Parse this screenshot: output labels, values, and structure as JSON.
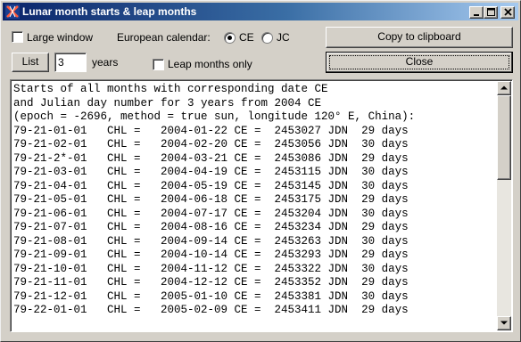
{
  "window": {
    "title": "Lunar month starts & leap months",
    "title_buttons": {
      "minimize": "_",
      "maximize": "□",
      "close": "×"
    }
  },
  "options": {
    "large_window_label": "Large window",
    "large_window_checked": false,
    "calendar_label": "European calendar:",
    "ce_label": "CE",
    "jc_label": "JC",
    "selected_calendar": "CE",
    "leap_months_only_label": "Leap months only",
    "leap_months_only_checked": false
  },
  "controls": {
    "list_button": "List",
    "years_value": "3",
    "years_label": "years",
    "copy_button": "Copy to clipboard",
    "close_button": "Close"
  },
  "output": {
    "header_lines": [
      "Starts of all months with corresponding date CE",
      "and Julian day number for 3 years from 2004 CE",
      "(epoch = -2696, method = true sun, longitude 120° E, China):"
    ],
    "columns": [
      "CHL",
      "CE",
      "JDN",
      "days"
    ],
    "rows": [
      {
        "chl": "79-21-01-01",
        "ce": "2004-01-22",
        "jdn": "2453027",
        "days": "29"
      },
      {
        "chl": "79-21-02-01",
        "ce": "2004-02-20",
        "jdn": "2453056",
        "days": "30"
      },
      {
        "chl": "79-21-2*-01",
        "ce": "2004-03-21",
        "jdn": "2453086",
        "days": "29"
      },
      {
        "chl": "79-21-03-01",
        "ce": "2004-04-19",
        "jdn": "2453115",
        "days": "30"
      },
      {
        "chl": "79-21-04-01",
        "ce": "2004-05-19",
        "jdn": "2453145",
        "days": "30"
      },
      {
        "chl": "79-21-05-01",
        "ce": "2004-06-18",
        "jdn": "2453175",
        "days": "29"
      },
      {
        "chl": "79-21-06-01",
        "ce": "2004-07-17",
        "jdn": "2453204",
        "days": "30"
      },
      {
        "chl": "79-21-07-01",
        "ce": "2004-08-16",
        "jdn": "2453234",
        "days": "29"
      },
      {
        "chl": "79-21-08-01",
        "ce": "2004-09-14",
        "jdn": "2453263",
        "days": "30"
      },
      {
        "chl": "79-21-09-01",
        "ce": "2004-10-14",
        "jdn": "2453293",
        "days": "29"
      },
      {
        "chl": "79-21-10-01",
        "ce": "2004-11-12",
        "jdn": "2453322",
        "days": "30"
      },
      {
        "chl": "79-21-11-01",
        "ce": "2004-12-12",
        "jdn": "2453352",
        "days": "29"
      },
      {
        "chl": "79-21-12-01",
        "ce": "2005-01-10",
        "jdn": "2453381",
        "days": "30"
      },
      {
        "chl": "79-22-01-01",
        "ce": "2005-02-09",
        "jdn": "2453411",
        "days": "29"
      }
    ]
  }
}
